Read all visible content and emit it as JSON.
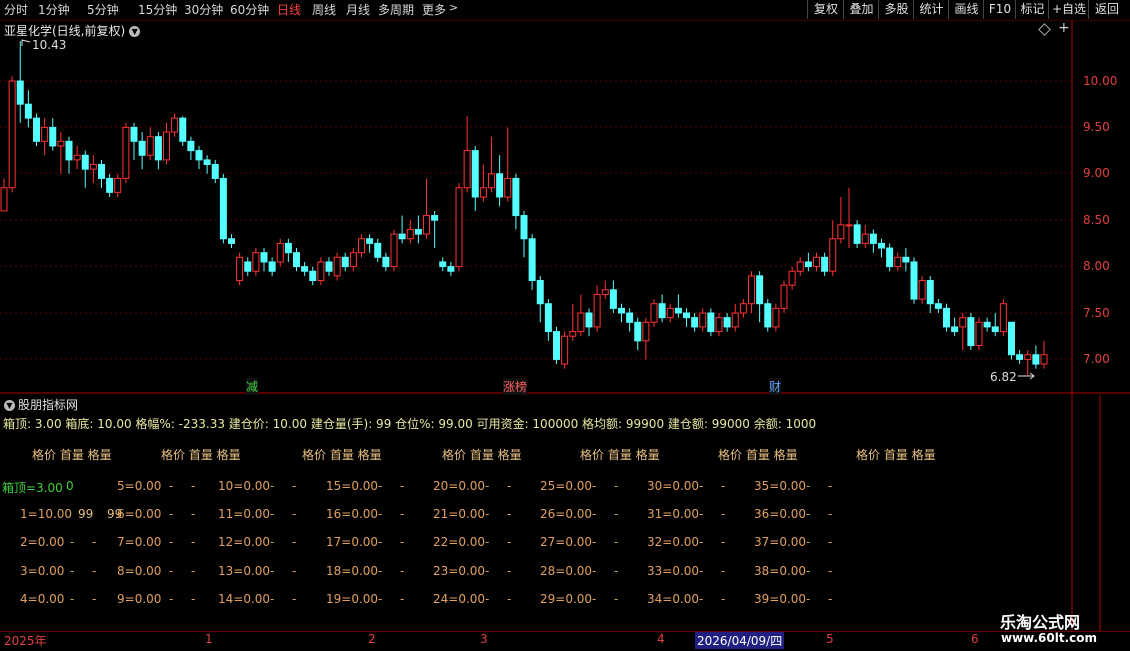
{
  "toolbar": {
    "periods": [
      "分时",
      "1分钟",
      "5分钟",
      "15分钟",
      "30分钟",
      "60分钟",
      "日线",
      "周线",
      "月线",
      "多周期",
      "更多"
    ],
    "active_period": "日线",
    "tools": [
      "复权",
      "叠加",
      "多股",
      "统计",
      "画线",
      "F10",
      "标记",
      "+自选",
      "返回"
    ]
  },
  "chart_header": {
    "stock_name": "亚星化学(日线,前复权)"
  },
  "chart_data": {
    "type": "candlestick",
    "y_ticks": [
      "10.00",
      "9.50",
      "9.00",
      "8.50",
      "8.00",
      "7.50",
      "7.00"
    ],
    "high_label": "10.43",
    "low_label": "6.82",
    "markers": [
      "减",
      "涨榜",
      "财"
    ],
    "candles": [
      [
        8.6,
        8.85,
        8.6,
        8.95
      ],
      [
        8.85,
        10.0,
        8.8,
        10.05
      ],
      [
        10.0,
        9.75,
        9.55,
        10.43
      ],
      [
        9.75,
        9.6,
        9.5,
        9.9
      ],
      [
        9.6,
        9.35,
        9.3,
        9.65
      ],
      [
        9.35,
        9.5,
        9.2,
        9.6
      ],
      [
        9.5,
        9.3,
        9.25,
        9.6
      ],
      [
        9.3,
        9.35,
        9.0,
        9.45
      ],
      [
        9.35,
        9.15,
        9.0,
        9.4
      ],
      [
        9.15,
        9.2,
        9.05,
        9.3
      ],
      [
        9.2,
        9.05,
        8.85,
        9.25
      ],
      [
        9.05,
        9.1,
        8.9,
        9.2
      ],
      [
        9.1,
        8.95,
        8.85,
        9.15
      ],
      [
        8.95,
        8.8,
        8.75,
        9.0
      ],
      [
        8.8,
        8.95,
        8.75,
        9.0
      ],
      [
        8.95,
        9.5,
        8.9,
        9.55
      ],
      [
        9.5,
        9.35,
        9.15,
        9.55
      ],
      [
        9.35,
        9.2,
        9.05,
        9.45
      ],
      [
        9.2,
        9.4,
        9.15,
        9.5
      ],
      [
        9.4,
        9.15,
        9.05,
        9.45
      ],
      [
        9.15,
        9.45,
        9.1,
        9.55
      ],
      [
        9.45,
        9.6,
        9.4,
        9.65
      ],
      [
        9.6,
        9.35,
        9.3,
        9.62
      ],
      [
        9.35,
        9.25,
        9.15,
        9.4
      ],
      [
        9.25,
        9.15,
        9.05,
        9.3
      ],
      [
        9.15,
        9.1,
        9.0,
        9.2
      ],
      [
        9.1,
        8.95,
        8.9,
        9.15
      ],
      [
        8.95,
        8.3,
        8.25,
        9.0
      ],
      [
        8.3,
        8.25,
        8.2,
        8.35
      ],
      [
        7.85,
        8.1,
        7.8,
        8.15
      ],
      [
        8.05,
        7.95,
        7.9,
        8.1
      ],
      [
        7.95,
        8.15,
        7.9,
        8.2
      ],
      [
        8.15,
        8.05,
        7.95,
        8.2
      ],
      [
        8.05,
        7.95,
        7.9,
        8.1
      ],
      [
        8.05,
        8.25,
        8.0,
        8.3
      ],
      [
        8.25,
        8.15,
        8.05,
        8.3
      ],
      [
        8.15,
        8.0,
        7.95,
        8.2
      ],
      [
        8.0,
        7.95,
        7.9,
        8.05
      ],
      [
        7.95,
        7.85,
        7.8,
        8.0
      ],
      [
        7.85,
        8.05,
        7.8,
        8.1
      ],
      [
        8.05,
        7.95,
        7.9,
        8.1
      ],
      [
        7.9,
        8.1,
        7.85,
        8.15
      ],
      [
        8.1,
        8.0,
        7.95,
        8.15
      ],
      [
        8.0,
        8.15,
        7.95,
        8.2
      ],
      [
        8.15,
        8.3,
        8.1,
        8.35
      ],
      [
        8.3,
        8.25,
        8.15,
        8.35
      ],
      [
        8.25,
        8.1,
        8.05,
        8.3
      ],
      [
        8.1,
        8.0,
        7.95,
        8.15
      ],
      [
        8.0,
        8.35,
        7.95,
        8.4
      ],
      [
        8.35,
        8.3,
        8.25,
        8.55
      ],
      [
        8.3,
        8.4,
        8.25,
        8.5
      ],
      [
        8.4,
        8.35,
        8.25,
        8.55
      ],
      [
        8.35,
        8.55,
        8.3,
        8.95
      ],
      [
        8.55,
        8.5,
        8.2,
        8.6
      ],
      [
        8.05,
        8.0,
        7.95,
        8.1
      ],
      [
        8.0,
        7.95,
        7.9,
        8.05
      ],
      [
        8.0,
        8.85,
        7.95,
        8.9
      ],
      [
        8.85,
        9.25,
        8.8,
        9.62
      ],
      [
        9.25,
        8.75,
        8.6,
        9.3
      ],
      [
        8.75,
        8.85,
        8.7,
        9.1
      ],
      [
        8.85,
        9.0,
        8.8,
        9.4
      ],
      [
        9.0,
        8.75,
        8.65,
        9.2
      ],
      [
        8.75,
        8.95,
        8.7,
        9.5
      ],
      [
        8.95,
        8.55,
        8.4,
        9.0
      ],
      [
        8.55,
        8.3,
        8.1,
        8.6
      ],
      [
        8.3,
        7.85,
        7.75,
        8.35
      ],
      [
        7.85,
        7.6,
        7.4,
        7.9
      ],
      [
        7.6,
        7.3,
        7.2,
        7.65
      ],
      [
        7.3,
        7.0,
        6.95,
        7.35
      ],
      [
        6.95,
        7.25,
        6.9,
        7.3
      ],
      [
        7.25,
        7.3,
        7.2,
        7.6
      ],
      [
        7.3,
        7.5,
        7.25,
        7.7
      ],
      [
        7.5,
        7.35,
        7.25,
        7.55
      ],
      [
        7.35,
        7.7,
        7.3,
        7.8
      ],
      [
        7.7,
        7.75,
        7.65,
        7.85
      ],
      [
        7.75,
        7.55,
        7.5,
        7.85
      ],
      [
        7.55,
        7.5,
        7.4,
        7.6
      ],
      [
        7.5,
        7.4,
        7.3,
        7.55
      ],
      [
        7.4,
        7.2,
        7.1,
        7.45
      ],
      [
        7.2,
        7.4,
        7.0,
        7.45
      ],
      [
        7.4,
        7.6,
        7.35,
        7.65
      ],
      [
        7.6,
        7.45,
        7.4,
        7.7
      ],
      [
        7.45,
        7.55,
        7.4,
        7.6
      ],
      [
        7.55,
        7.5,
        7.45,
        7.7
      ],
      [
        7.5,
        7.45,
        7.35,
        7.55
      ],
      [
        7.45,
        7.35,
        7.3,
        7.5
      ],
      [
        7.35,
        7.5,
        7.3,
        7.55
      ],
      [
        7.5,
        7.3,
        7.25,
        7.55
      ],
      [
        7.3,
        7.45,
        7.25,
        7.5
      ],
      [
        7.45,
        7.35,
        7.3,
        7.5
      ],
      [
        7.35,
        7.5,
        7.3,
        7.6
      ],
      [
        7.5,
        7.6,
        7.45,
        7.65
      ],
      [
        7.6,
        7.9,
        7.5,
        7.95
      ],
      [
        7.9,
        7.6,
        7.4,
        7.95
      ],
      [
        7.6,
        7.35,
        7.3,
        7.65
      ],
      [
        7.35,
        7.55,
        7.3,
        7.6
      ],
      [
        7.55,
        7.8,
        7.5,
        7.85
      ],
      [
        7.8,
        7.95,
        7.75,
        8.0
      ],
      [
        7.95,
        8.05,
        7.9,
        8.1
      ],
      [
        8.05,
        8.0,
        7.95,
        8.15
      ],
      [
        8.0,
        8.1,
        7.95,
        8.15
      ],
      [
        8.1,
        7.95,
        7.9,
        8.15
      ],
      [
        7.95,
        8.3,
        7.9,
        8.5
      ],
      [
        8.3,
        8.45,
        8.25,
        8.75
      ],
      [
        8.45,
        8.45,
        8.2,
        8.85
      ],
      [
        8.45,
        8.25,
        8.2,
        8.5
      ],
      [
        8.25,
        8.35,
        8.2,
        8.45
      ],
      [
        8.35,
        8.25,
        8.15,
        8.4
      ],
      [
        8.25,
        8.2,
        8.1,
        8.3
      ],
      [
        8.2,
        8.0,
        7.95,
        8.25
      ],
      [
        8.0,
        8.1,
        7.95,
        8.15
      ],
      [
        8.1,
        8.05,
        7.95,
        8.2
      ],
      [
        8.05,
        7.65,
        7.6,
        8.1
      ],
      [
        7.65,
        7.85,
        7.6,
        7.9
      ],
      [
        7.85,
        7.6,
        7.5,
        7.9
      ],
      [
        7.6,
        7.55,
        7.5,
        7.65
      ],
      [
        7.55,
        7.35,
        7.3,
        7.6
      ],
      [
        7.35,
        7.3,
        7.25,
        7.45
      ],
      [
        7.35,
        7.45,
        7.1,
        7.5
      ],
      [
        7.45,
        7.15,
        7.1,
        7.5
      ],
      [
        7.15,
        7.4,
        7.1,
        7.45
      ],
      [
        7.4,
        7.35,
        7.3,
        7.45
      ],
      [
        7.35,
        7.3,
        7.25,
        7.5
      ],
      [
        7.3,
        7.6,
        7.25,
        7.65
      ],
      [
        7.4,
        7.05,
        7.0,
        7.4
      ],
      [
        7.05,
        7.0,
        6.95,
        7.1
      ],
      [
        7.0,
        7.05,
        6.82,
        7.1
      ],
      [
        7.05,
        6.95,
        6.9,
        7.15
      ],
      [
        6.95,
        7.05,
        6.9,
        7.2
      ]
    ]
  },
  "indicator": {
    "title": "股朋指标网",
    "params": "箱顶: 3.00  箱底: 10.00  格幅%: -233.33  建仓价: 10.00  建仓量(手): 99  仓位%: 99.00  可用资金: 100000  格均额: 99900  建仓额: 99000  余额: 1000",
    "header_group": "格价  首量  格量",
    "box_top_label": "箱顶=3.00",
    "box_top_value": "0",
    "row1_qty": "99",
    "row1_val": "99",
    "dash": "-",
    "cells": [
      "1=10.00",
      "2=0.00",
      "3=0.00",
      "4=0.00",
      "5=0.00",
      "6=0.00",
      "7=0.00",
      "8=0.00",
      "9=0.00",
      "10=0.00",
      "11=0.00",
      "12=0.00",
      "13=0.00",
      "14=0.00",
      "15=0.00",
      "16=0.00",
      "17=0.00",
      "18=0.00",
      "19=0.00",
      "20=0.00",
      "21=0.00",
      "22=0.00",
      "23=0.00",
      "24=0.00",
      "25=0.00",
      "26=0.00",
      "27=0.00",
      "28=0.00",
      "29=0.00",
      "30=0.00",
      "31=0.00",
      "32=0.00",
      "33=0.00",
      "34=0.00",
      "35=0.00",
      "36=0.00",
      "37=0.00",
      "38=0.00",
      "39=0.00"
    ]
  },
  "date_axis": {
    "labels": [
      "2025年",
      "1",
      "2",
      "3",
      "4",
      "2026/04/09/四",
      "5",
      "6"
    ]
  },
  "watermark": {
    "line1": "乐淘公式网",
    "line2": "www.60lt.com"
  }
}
